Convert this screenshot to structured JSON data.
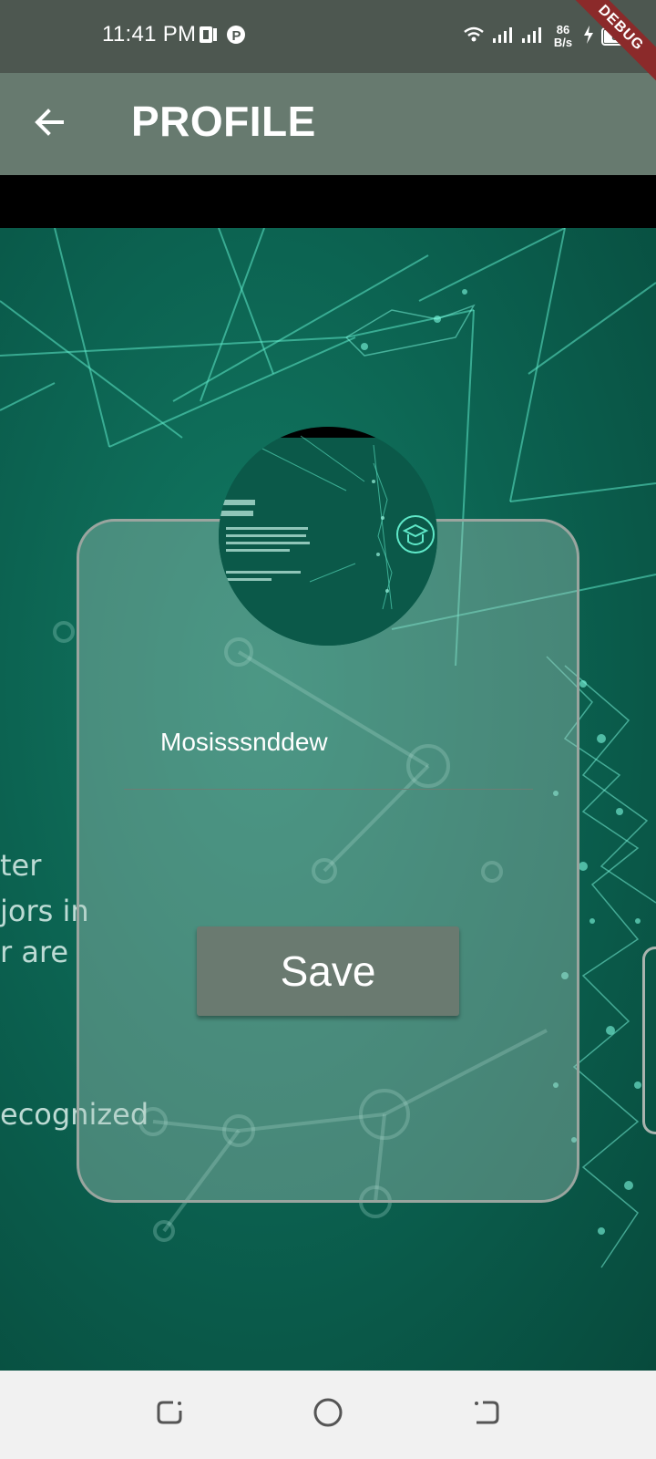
{
  "status_bar": {
    "time": "11:41 PM",
    "net_speed_value": "86",
    "net_speed_unit": "B/s",
    "battery_level": "85",
    "debug_label": "DEBUG"
  },
  "app_bar": {
    "back_icon": "arrow-left-icon",
    "title": "PROFILE"
  },
  "background": {
    "text_lines": [
      "ter",
      "jors in",
      "r are",
      "ecognized"
    ]
  },
  "profile": {
    "avatar_icon": "graduation-cap-icon",
    "name_value": "Mosisssnddew",
    "save_label": "Save"
  },
  "nav_bar": {
    "recents_icon": "recents-icon",
    "home_icon": "home-circle-icon",
    "back_icon": "nav-back-icon"
  },
  "colors": {
    "status_bar": "#4d5750",
    "app_bar": "#677a6f",
    "save_button": "#6a7a70",
    "background": "#0b5f4e",
    "nav_bar": "#f1f1f1"
  }
}
